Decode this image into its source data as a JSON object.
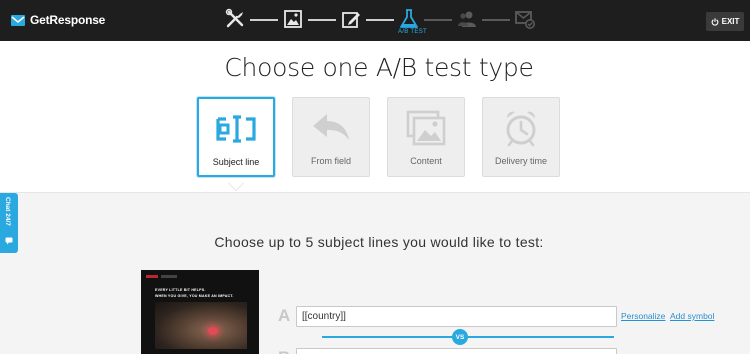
{
  "app": {
    "logo_text": "GetResponse"
  },
  "header": {
    "steps": [
      {
        "icon": "tools-icon",
        "active": false
      },
      {
        "icon": "template-image-icon",
        "active": false
      },
      {
        "icon": "edit-icon",
        "active": false
      },
      {
        "icon": "flask-icon",
        "active": true,
        "label": "A/B TEST"
      },
      {
        "icon": "contacts-icon",
        "active": false
      },
      {
        "icon": "send-mail-icon",
        "active": false
      }
    ],
    "exit_label": "EXIT"
  },
  "main": {
    "title": "Choose one A/B test type",
    "test_types": [
      {
        "label": "Subject line",
        "icon": "subject-line-icon",
        "selected": true
      },
      {
        "label": "From field",
        "icon": "reply-arrow-icon",
        "selected": false
      },
      {
        "label": "Content",
        "icon": "images-icon",
        "selected": false
      },
      {
        "label": "Delivery time",
        "icon": "alarm-clock-icon",
        "selected": false
      }
    ],
    "subtitle": "Choose up to 5 subject lines you would like to test:"
  },
  "preview": {
    "line1": "EVERY LITTLE BIT HELPS.",
    "line2": "WHEN YOU GIVE, YOU MAKE AN IMPACT."
  },
  "subjects": {
    "a_letter": "A",
    "a_value": "[[country]]",
    "b_letter": "B",
    "vs_label": "VS",
    "personalize_label": "Personalize",
    "add_symbol_label": "Add symbol"
  },
  "chat": {
    "label": "Chat 24/7"
  },
  "colors": {
    "accent": "#2aa8e0",
    "topbar": "#1e1e1e"
  }
}
